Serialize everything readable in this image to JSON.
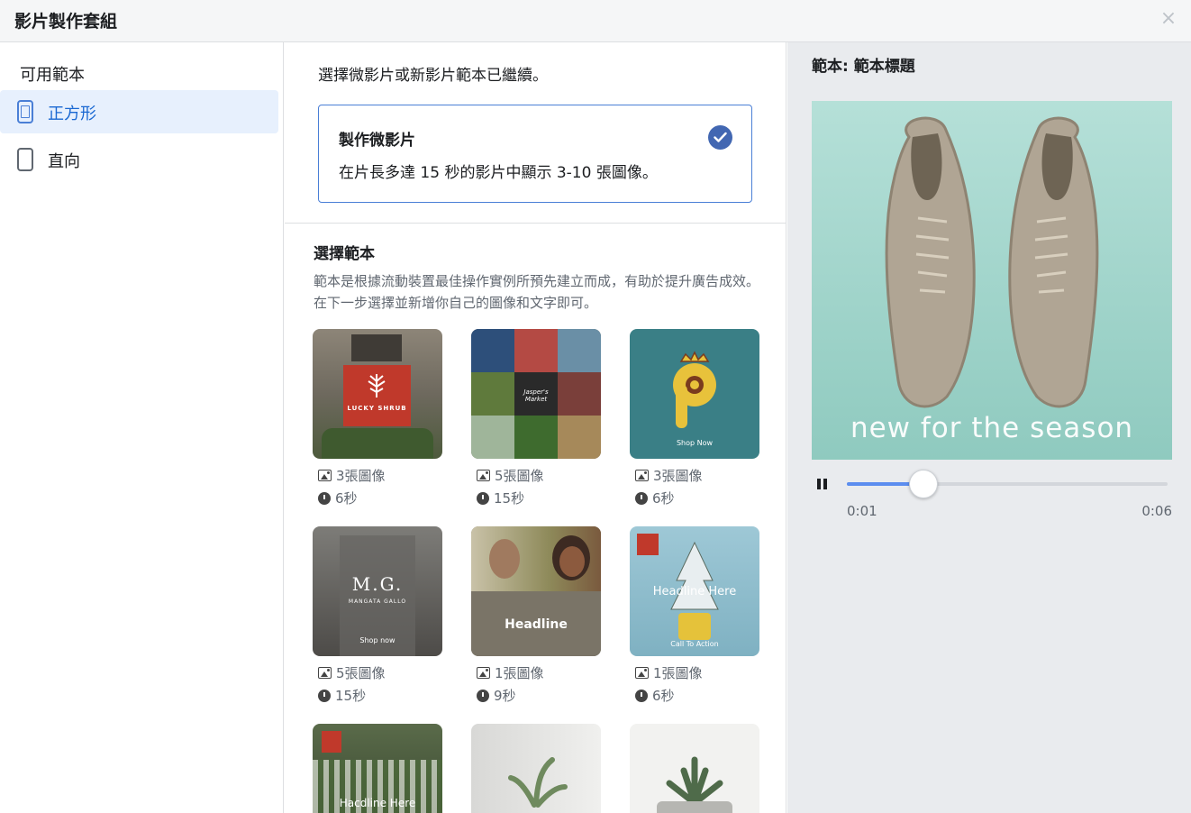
{
  "header": {
    "title": "影片製作套組",
    "close_label": "×"
  },
  "sidebar": {
    "heading": "可用範本",
    "items": [
      {
        "label": "正方形",
        "icon": "square-phone-icon",
        "active": true
      },
      {
        "label": "直向",
        "icon": "vertical-phone-icon",
        "active": false
      }
    ]
  },
  "main": {
    "intro": "選擇微影片或新影片範本已繼續。",
    "option": {
      "title": "製作微影片",
      "description": "在片長多達 15 秒的影片中顯示 3-10 張圖像。",
      "selected": true
    },
    "templates_title": "選擇範本",
    "templates_desc": "範本是根據流動裝置最佳操作實例所預先建立而成，有助於提升廣告成效。在下一步選擇並新增你自己的圖像和文字即可。",
    "templates": [
      {
        "images": "3張圖像",
        "duration": "6秒",
        "overlay": "LUCKY SHRUB"
      },
      {
        "images": "5張圖像",
        "duration": "15秒",
        "overlay": "Jasper's Market"
      },
      {
        "images": "3張圖像",
        "duration": "6秒",
        "overlay": "Shop Now"
      },
      {
        "images": "5張圖像",
        "duration": "15秒",
        "overlay": "M.G.",
        "overlay_sub": "MANGATA GALLO",
        "overlay_cta": "Shop now"
      },
      {
        "images": "1張圖像",
        "duration": "9秒",
        "overlay": "Headline"
      },
      {
        "images": "1張圖像",
        "duration": "6秒",
        "overlay": "Headline Here",
        "overlay_cta": "Call To Action"
      },
      {
        "overlay": "Hacdline Here"
      },
      {
        "overlay": ""
      },
      {
        "overlay": ""
      }
    ]
  },
  "preview": {
    "title": "範本: 範本標題",
    "caption": "new for the season",
    "current_time": "0:01",
    "end_time": "0:06",
    "progress": 0.24
  },
  "colors": {
    "accent": "#4267b2",
    "selected_bg": "#e7f0fd",
    "teal": "#3a7f86"
  }
}
